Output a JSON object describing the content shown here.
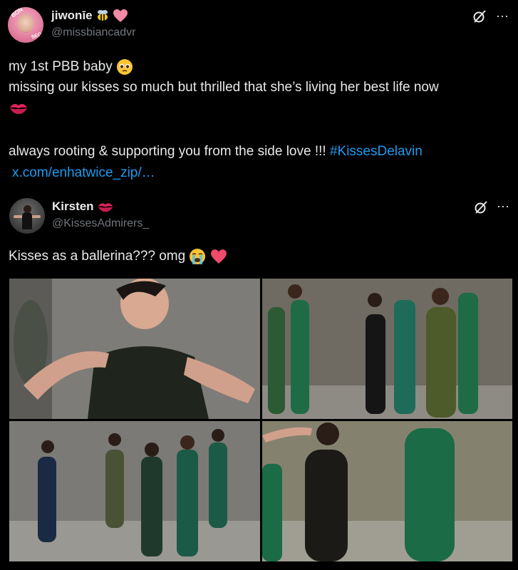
{
  "tweet": {
    "display_name": "jiwonīe",
    "handle": "@missbiancadvr",
    "lines": [
      "my 1st PBB baby",
      "missing our kisses so much but thrilled that she’s living her best life now"
    ],
    "line3": "always rooting & supporting you from the side love !!! ",
    "hashtag": "#KissesDelavin",
    "link": "x.com/enhatwice_zip/…",
    "avatar_text_top": "BON",
    "avatar_text_bottom": "SEO"
  },
  "quote": {
    "display_name": "Kirsten",
    "handle": "@KissesAdmirers_",
    "text": "Kisses as a ballerina??? omg"
  },
  "icons": {
    "grok": "grok-icon",
    "more": "more-icon",
    "more_glyph": "···"
  },
  "colors": {
    "background": "#000000",
    "text": "#e7e9ea",
    "secondary": "#71767b",
    "link": "#1d9bf0"
  }
}
